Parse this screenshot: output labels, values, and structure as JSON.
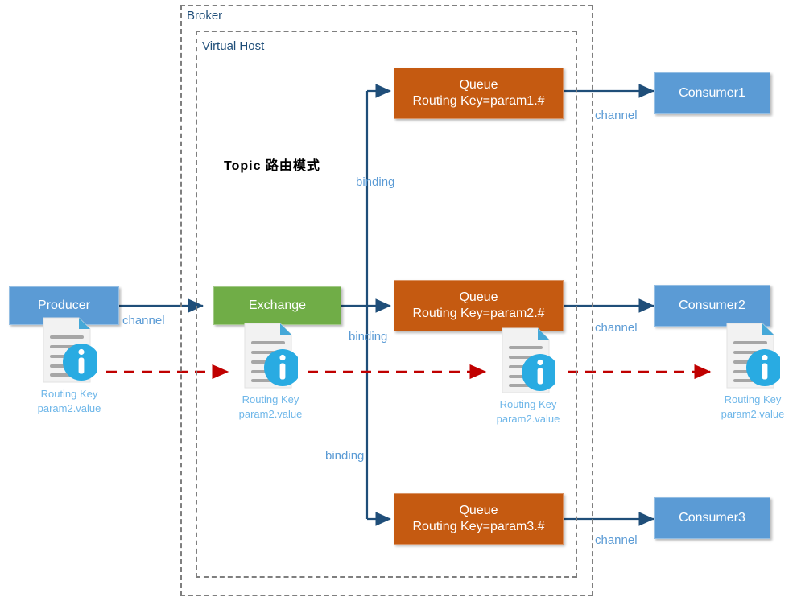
{
  "diagram": {
    "title": "Topic 路由模式",
    "containers": [
      {
        "id": "broker",
        "label": "Broker"
      },
      {
        "id": "virtual-host",
        "label": "Virtual Host"
      }
    ],
    "nodes": [
      {
        "id": "producer",
        "kind": "producer",
        "color": "#5B9BD5",
        "line1": "Producer",
        "line2": ""
      },
      {
        "id": "exchange",
        "kind": "exchange",
        "color": "#70AD47",
        "line1": "Exchange",
        "line2": ""
      },
      {
        "id": "queue1",
        "kind": "queue",
        "color": "#C55A11",
        "line1": "Queue",
        "line2": "Routing Key=param1.#"
      },
      {
        "id": "queue2",
        "kind": "queue",
        "color": "#C55A11",
        "line1": "Queue",
        "line2": "Routing Key=param2.#"
      },
      {
        "id": "queue3",
        "kind": "queue",
        "color": "#C55A11",
        "line1": "Queue",
        "line2": "Routing Key=param3.#"
      },
      {
        "id": "consumer1",
        "kind": "consumer",
        "color": "#5B9BD5",
        "line1": "Consumer1",
        "line2": ""
      },
      {
        "id": "consumer2",
        "kind": "consumer",
        "color": "#5B9BD5",
        "line1": "Consumer2",
        "line2": ""
      },
      {
        "id": "consumer3",
        "kind": "consumer",
        "color": "#5B9BD5",
        "line1": "Consumer3",
        "line2": ""
      }
    ],
    "edge_labels": {
      "channel_producer": "channel",
      "channel_consumer1": "channel",
      "channel_consumer2": "channel",
      "channel_consumer3": "channel",
      "binding_top": "binding",
      "binding_mid": "binding",
      "binding_bottom": "binding"
    },
    "messages": [
      {
        "id": "msg-producer",
        "icon": "document-info-icon",
        "line1": "Routing Key",
        "line2": "param2.value"
      },
      {
        "id": "msg-exchange",
        "icon": "document-info-icon",
        "line1": "Routing Key",
        "line2": "param2.value"
      },
      {
        "id": "msg-queue2",
        "icon": "document-info-icon",
        "line1": "Routing Key",
        "line2": "param2.value"
      },
      {
        "id": "msg-consumer2",
        "icon": "document-info-icon",
        "line1": "Routing Key",
        "line2": "param2.value"
      }
    ],
    "colors": {
      "blue_node": "#5B9BD5",
      "green_node": "#70AD47",
      "orange_node": "#C55A11",
      "arrow_solid": "#1F4E79",
      "arrow_dashed": "#C00000",
      "container_border": "#7f7f7f",
      "label_blue": "#5B9BD5",
      "caption_blue": "#6FB7E9",
      "info_badge": "#29ABE2"
    }
  }
}
